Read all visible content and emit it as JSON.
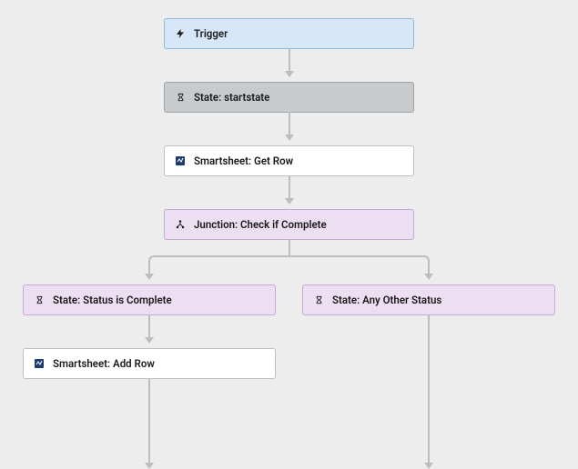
{
  "nodes": {
    "trigger": {
      "label": "Trigger",
      "bg": "#d6e8f7",
      "border": "#93b9d8"
    },
    "startstate": {
      "label": "State: startstate",
      "bg": "#c7cbcd",
      "border": "#9fa4a7"
    },
    "getrow": {
      "label": "Smartsheet: Get Row",
      "bg": "#ffffff",
      "border": "#bfbfbf"
    },
    "junction": {
      "label": "Junction: Check if Complete",
      "bg": "#ecdff1",
      "border": "#c8a9d4"
    },
    "state_complete": {
      "label": "State: Status is Complete",
      "bg": "#ecdff1",
      "border": "#c8a9d4"
    },
    "state_other": {
      "label": "State: Any Other Status",
      "bg": "#ecdff1",
      "border": "#c8a9d4"
    },
    "addrow": {
      "label": "Smartsheet: Add Row",
      "bg": "#ffffff",
      "border": "#bfbfbf"
    }
  },
  "chart_data": {
    "type": "flowchart",
    "nodes": [
      {
        "id": "trigger",
        "label": "Trigger",
        "kind": "trigger"
      },
      {
        "id": "startstate",
        "label": "State: startstate",
        "kind": "state"
      },
      {
        "id": "getrow",
        "label": "Smartsheet: Get Row",
        "kind": "action"
      },
      {
        "id": "junction",
        "label": "Junction: Check if Complete",
        "kind": "junction"
      },
      {
        "id": "state_complete",
        "label": "State: Status is Complete",
        "kind": "state"
      },
      {
        "id": "state_other",
        "label": "State: Any Other Status",
        "kind": "state"
      },
      {
        "id": "addrow",
        "label": "Smartsheet: Add Row",
        "kind": "action"
      }
    ],
    "edges": [
      {
        "from": "trigger",
        "to": "startstate"
      },
      {
        "from": "startstate",
        "to": "getrow"
      },
      {
        "from": "getrow",
        "to": "junction"
      },
      {
        "from": "junction",
        "to": "state_complete"
      },
      {
        "from": "junction",
        "to": "state_other"
      },
      {
        "from": "state_complete",
        "to": "addrow"
      }
    ]
  }
}
